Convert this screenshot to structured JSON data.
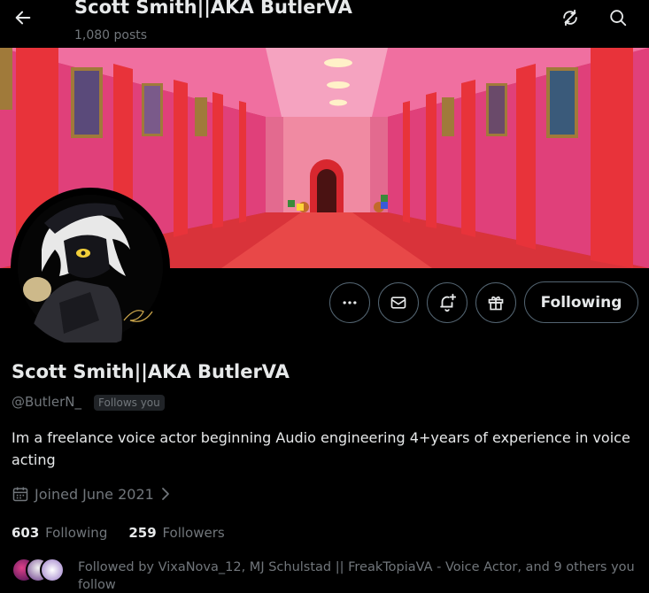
{
  "header": {
    "title": "Scott Smith||AKA ButlerVA",
    "posts_count": "1,080 posts"
  },
  "profile": {
    "display_name": "Scott Smith||AKA ButlerVA",
    "handle": "@ButlerN_",
    "follows_you_badge": "Follows you",
    "bio": "Im a freelance voice actor beginning Audio engineering 4+years of experience in voice acting",
    "joined": "Joined June 2021",
    "following_count": "603",
    "following_label": "Following",
    "followers_count": "259",
    "followers_label": "Followers",
    "followed_by": "Followed by VixaNova_12, MJ Schulstad || FreakTopiaVA - Voice Actor, and 9 others you follow"
  },
  "actions": {
    "following_button": "Following"
  },
  "colors": {
    "background": "#000000",
    "text_primary": "#e7e9ea",
    "text_secondary": "#71767b",
    "border": "#536471",
    "banner_wall": "#e0407a",
    "banner_pillar": "#e8333a",
    "banner_floor": "#d9333a"
  },
  "icons": {
    "back": "arrow-left-icon",
    "top_right_1": "refresh-slash-icon",
    "top_right_2": "search-icon",
    "more": "more-horizontal-icon",
    "message": "mail-icon",
    "notify": "bell-plus-icon",
    "gift": "gift-icon",
    "calendar": "calendar-icon"
  }
}
